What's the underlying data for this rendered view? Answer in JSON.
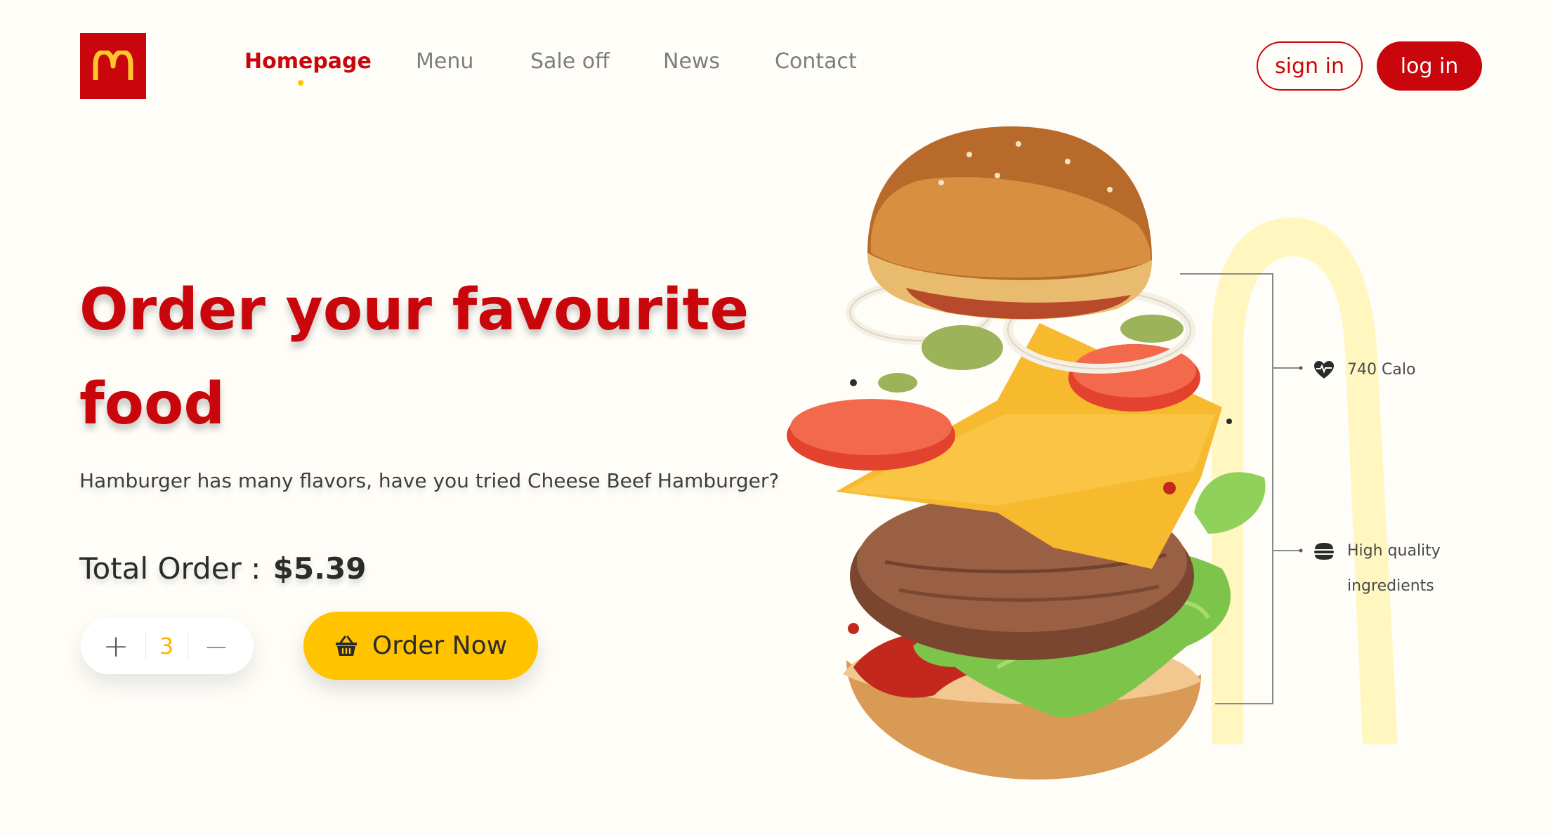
{
  "brand": {
    "logo_letter": "M",
    "colors": {
      "red": "#c8060b",
      "yellow": "#ffc300"
    }
  },
  "nav": {
    "items": [
      {
        "label": "Homepage",
        "active": true
      },
      {
        "label": "Menu",
        "active": false
      },
      {
        "label": "Sale off",
        "active": false
      },
      {
        "label": "News",
        "active": false
      },
      {
        "label": "Contact",
        "active": false
      }
    ]
  },
  "auth": {
    "signin_label": "sign in",
    "login_label": "log in"
  },
  "hero": {
    "title_line1": "Order your favourite",
    "title_line2": "food",
    "subtitle": "Hamburger has many flavors, have you tried Cheese Beef Hamburger?",
    "total_label": "Total Order :",
    "total_price": "$5.39",
    "quantity": "3",
    "plus_symbol": "+",
    "minus_symbol": "—",
    "order_button": "Order Now"
  },
  "product_info": {
    "calories": "740 Calo",
    "quality_line1": "High quality",
    "quality_line2": "ingredients",
    "icons": [
      "heart-pulse-icon",
      "burger-icon",
      "basket-icon"
    ]
  }
}
